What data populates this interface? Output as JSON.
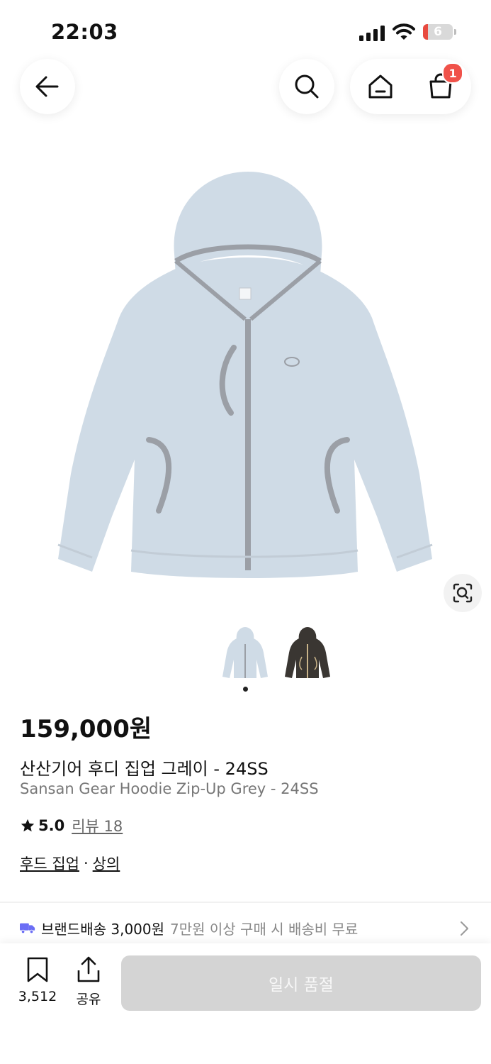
{
  "status_bar": {
    "time": "22:03",
    "battery": "6"
  },
  "nav": {
    "cart_count": "1"
  },
  "product": {
    "price": "159,000원",
    "name_ko": "산산기어 후디 집업 그레이 - 24SS",
    "name_en": "Sansan Gear Hoodie Zip-Up Grey - 24SS",
    "rating": "5.0",
    "review_label": "리뷰 18",
    "categories": [
      "후드 집업",
      "상의"
    ],
    "category_separator": "·",
    "colors": {
      "light": "#cfdbe6",
      "dark": "#3a3632",
      "trim": "#9b9fa6"
    }
  },
  "shipping": {
    "main": "브랜드배송 3,000원",
    "sub": "7만원 이상 구매 시 배송비 무료"
  },
  "bottom": {
    "bookmark_count": "3,512",
    "share_label": "공유",
    "buy_label": "일시 품절"
  }
}
